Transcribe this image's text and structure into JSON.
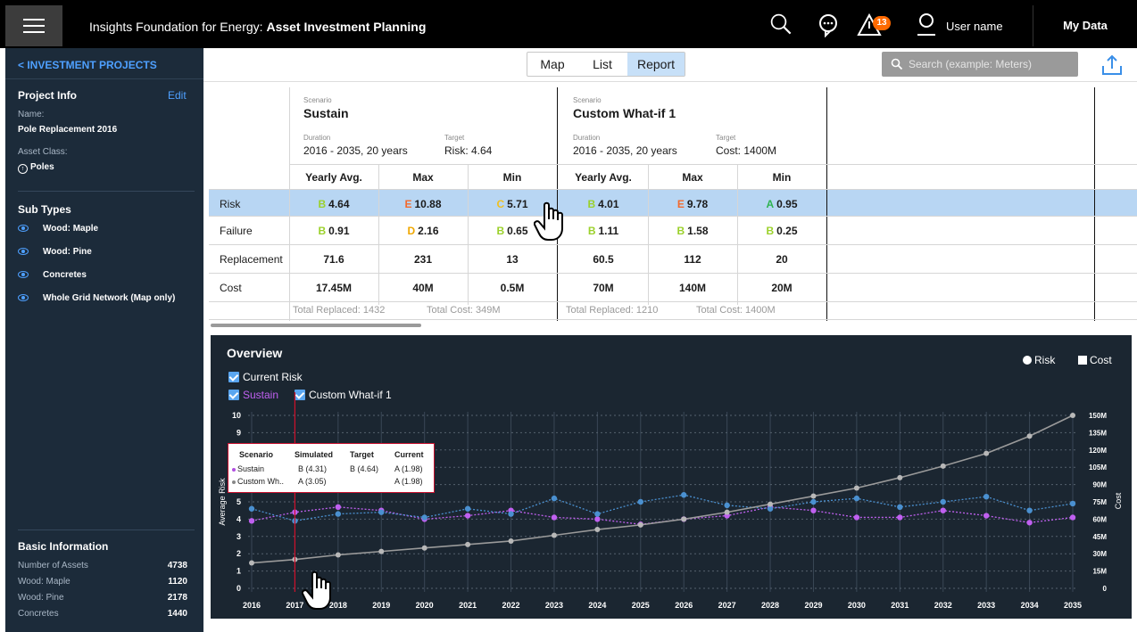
{
  "app": {
    "title_prefix": "Insights Foundation for Energy: ",
    "title_bold": "Asset Investment Planning",
    "user_name": "User name",
    "my_data": "My Data",
    "alert_count": "13"
  },
  "sidebar": {
    "back_label": "< INVESTMENT PROJECTS",
    "project_info": {
      "heading": "Project Info",
      "edit": "Edit",
      "name_label": "Name:",
      "name_value": "Pole Replacement 2016",
      "asset_class_label": "Asset Class:",
      "asset_class_value": "Poles"
    },
    "sub_types": {
      "heading": "Sub Types",
      "items": [
        "Wood: Maple",
        "Wood: Pine",
        "Concretes",
        "Whole Grid Network (Map only)"
      ]
    },
    "basic_info": {
      "heading": "Basic Information",
      "rows": [
        {
          "label": "Number of Assets",
          "value": "4738"
        },
        {
          "label": "Wood: Maple",
          "value": "1120"
        },
        {
          "label": "Wood: Pine",
          "value": "2178"
        },
        {
          "label": "Concretes",
          "value": "1440"
        }
      ]
    }
  },
  "toolbar": {
    "views": [
      "Map",
      "List",
      "Report"
    ],
    "active_view": "Report",
    "search_placeholder": "Search (example: Meters)"
  },
  "report": {
    "scenario_label": "Scenario",
    "duration_label": "Duration",
    "target_label": "Target",
    "scenarios": [
      {
        "name": "Sustain",
        "duration": "2016 - 2035, 20 years",
        "target": "Risk: 4.64",
        "totals_replaced": "Total Replaced: 1432",
        "totals_cost": "Total Cost: 349M"
      },
      {
        "name": "Custom What-if 1",
        "duration": "2016 - 2035, 20 years",
        "target": "Cost: 1400M",
        "totals_replaced": "Total Replaced: 1210",
        "totals_cost": "Total Cost: 1400M"
      }
    ],
    "columns": [
      "Yearly Avg.",
      "Max",
      "Min",
      "Yearly Avg.",
      "Max",
      "Min"
    ],
    "rows": [
      {
        "label": "Risk",
        "cells": [
          {
            "grade": "B",
            "value": "4.64"
          },
          {
            "grade": "E",
            "value": "10.88"
          },
          {
            "grade": "C",
            "value": "5.71"
          },
          {
            "grade": "B",
            "value": "4.01"
          },
          {
            "grade": "E",
            "value": "9.78"
          },
          {
            "grade": "A",
            "value": "0.95"
          }
        ]
      },
      {
        "label": "Failure",
        "cells": [
          {
            "grade": "B",
            "value": "0.91"
          },
          {
            "grade": "D",
            "value": "2.16"
          },
          {
            "grade": "B",
            "value": "0.65"
          },
          {
            "grade": "B",
            "value": "1.11"
          },
          {
            "grade": "B",
            "value": "1.58"
          },
          {
            "grade": "B",
            "value": "0.25"
          }
        ]
      },
      {
        "label": "Replacement",
        "cells": [
          {
            "grade": "",
            "value": "71.6"
          },
          {
            "grade": "",
            "value": "231"
          },
          {
            "grade": "",
            "value": "13"
          },
          {
            "grade": "",
            "value": "60.5"
          },
          {
            "grade": "",
            "value": "112"
          },
          {
            "grade": "",
            "value": "20"
          }
        ]
      },
      {
        "label": "Cost",
        "cells": [
          {
            "grade": "",
            "value": "17.45M"
          },
          {
            "grade": "",
            "value": "40M"
          },
          {
            "grade": "",
            "value": "0.5M"
          },
          {
            "grade": "",
            "value": "70M"
          },
          {
            "grade": "",
            "value": "140M"
          },
          {
            "grade": "",
            "value": "20M"
          }
        ]
      }
    ],
    "grade_colors": {
      "A": "#2fb350",
      "B": "#9bd12b",
      "C": "#f0c020",
      "D": "#f0a800",
      "E": "#f26a2e"
    }
  },
  "overview": {
    "title": "Overview",
    "checkboxes": [
      "Current Risk",
      "Sustain",
      "Custom What-if 1"
    ],
    "legend": [
      {
        "name": "Risk",
        "shape": "circle"
      },
      {
        "name": "Cost",
        "shape": "square"
      }
    ],
    "tooltip": {
      "headers": [
        "Scenario",
        "Simulated",
        "Target",
        "Current"
      ],
      "rows": [
        {
          "scenario": "Sustain",
          "simulated": "B (4.31)",
          "target": "B (4.64)",
          "current": "A (1.98)",
          "color": "#b04fe0"
        },
        {
          "scenario": "Custom Wh..",
          "simulated": "A (3.05)",
          "target": "",
          "current": "A (1.98)",
          "color": "#888888"
        }
      ]
    }
  },
  "chart_data": {
    "type": "line",
    "x": [
      2016,
      2017,
      2018,
      2019,
      2020,
      2021,
      2022,
      2023,
      2024,
      2025,
      2026,
      2027,
      2028,
      2029,
      2030,
      2031,
      2032,
      2033,
      2034,
      2035
    ],
    "x_tick_labels": [
      "2016",
      "2017",
      "2018",
      "2019",
      "2020",
      "2021",
      "2022",
      "2023",
      "2024",
      "2025",
      "2026",
      "2027",
      "2028",
      "2029",
      "2030",
      "2031",
      "2032",
      "2033",
      "2034",
      "2035"
    ],
    "ylabel": "Average Risk",
    "ylim": [
      0,
      10
    ],
    "y_ticks": [
      0,
      1,
      2,
      3,
      4,
      5,
      6,
      7,
      8,
      9,
      10
    ],
    "y2label": "Cost",
    "y2lim": [
      0,
      150
    ],
    "y2_tick_labels": [
      "0",
      "15M",
      "30M",
      "45M",
      "60M",
      "75M",
      "90M",
      "105M",
      "120M",
      "135M",
      "150M"
    ],
    "grid": true,
    "legend": "top-right",
    "series": [
      {
        "name": "Sustain",
        "axis": "left",
        "color": "#c060f0",
        "values": [
          3.9,
          4.4,
          4.7,
          4.5,
          4.0,
          4.2,
          4.5,
          4.1,
          4.0,
          3.7,
          4.0,
          4.2,
          4.7,
          4.5,
          4.1,
          4.1,
          4.5,
          4.2,
          3.8,
          4.1
        ]
      },
      {
        "name": "Custom What-if 1",
        "axis": "left",
        "color": "#4a90d0",
        "values": [
          4.6,
          3.9,
          4.3,
          4.4,
          4.1,
          4.6,
          4.3,
          5.2,
          4.3,
          5.0,
          5.4,
          4.8,
          4.6,
          5.0,
          5.2,
          4.7,
          5.0,
          5.3,
          4.5,
          4.9
        ]
      },
      {
        "name": "Cost",
        "axis": "right",
        "color": "#9a9a9a",
        "values": [
          22,
          25,
          29,
          32,
          35,
          38,
          41,
          46,
          51,
          55,
          60,
          66,
          73,
          80,
          87,
          96,
          106,
          117,
          132,
          150
        ]
      }
    ],
    "highlight_x": 2017
  }
}
